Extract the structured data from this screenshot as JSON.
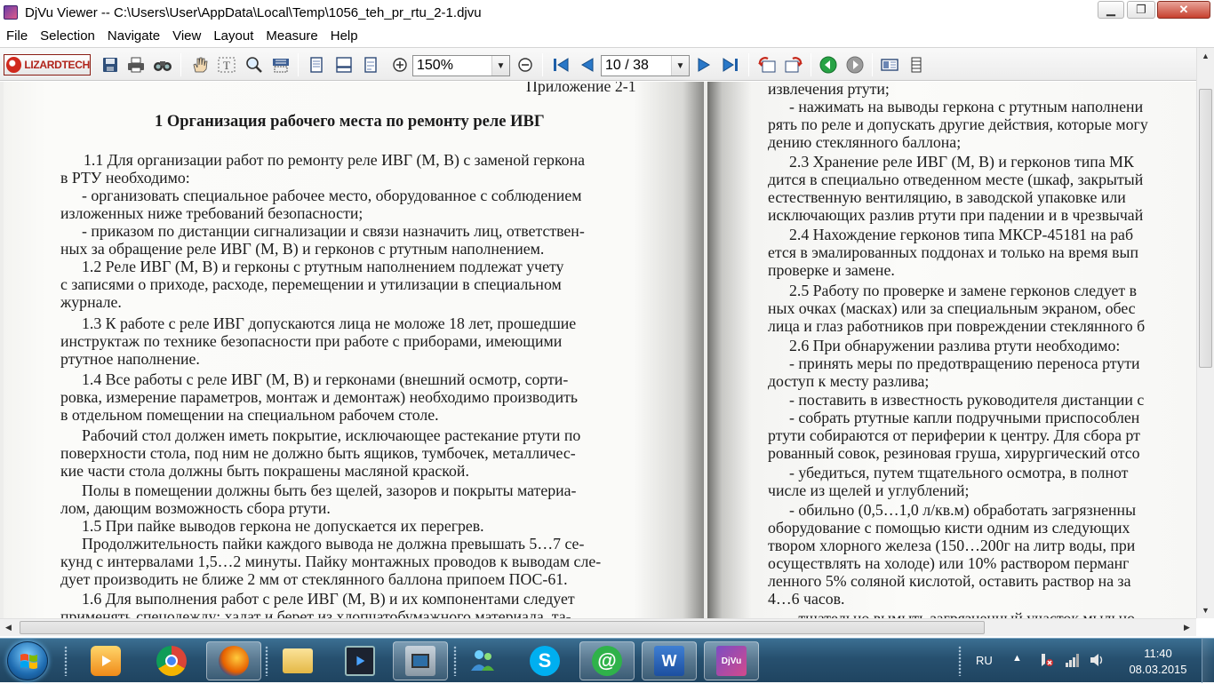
{
  "window": {
    "title": "DjVu Viewer -- C:\\Users\\User\\AppData\\Local\\Temp\\1056_teh_pr_rtu_2-1.djvu",
    "minimize_icon": "minimize-icon",
    "maximize_icon": "restore-icon",
    "close_icon": "close-icon"
  },
  "menu": [
    "File",
    "Selection",
    "Navigate",
    "View",
    "Layout",
    "Measure",
    "Help"
  ],
  "toolbar": {
    "logo_text": "LIZARDTECH",
    "zoom_value": "150%",
    "page_value": "10 / 38",
    "icons": [
      "save-icon",
      "print-icon",
      "find-icon",
      "hand-icon",
      "text-select-icon",
      "zoom-tool-icon",
      "region-select-icon",
      "single-page-icon",
      "continuous-page-icon",
      "facing-page-icon",
      "zoom-in-icon",
      "zoom-out-icon",
      "first-page-icon",
      "previous-page-icon",
      "next-page-icon",
      "last-page-icon",
      "rotate-left-icon",
      "rotate-right-icon",
      "back-icon",
      "forward-icon",
      "thumbnails-icon",
      "page-layout-icon"
    ]
  },
  "document": {
    "left_page": [
      "Приложение 2-1",
      "1 Организация рабочего места по ремонту реле ИВГ",
      "1.1 Для организации работ по ремонту реле ИВГ (М, В) с заменой геркона",
      "в РТУ необходимо:",
      "- организовать специальное рабочее место, оборудованное с соблюдением",
      "изложенных ниже требований безопасности;",
      "- приказом по дистанции сигнализации и связи назначить лиц, ответствен-",
      "ных за обращение реле ИВГ (М, В) и герконов с ртутным наполнением.",
      "1.2 Реле ИВГ (М, В) и герконы с ртутным наполнением подлежат учету",
      "с записями о приходе, расходе, перемещении и утилизации в специальном",
      "журнале.",
      "1.3 К работе с реле ИВГ допускаются лица не моложе 18 лет, прошедшие",
      "инструктаж по технике безопасности при работе с приборами, имеющими",
      "ртутное наполнение.",
      "1.4 Все работы с реле ИВГ (М, В) и герконами (внешний осмотр, сорти-",
      "ровка, измерение параметров, монтаж и демонтаж) необходимо производить",
      "в отдельном помещении на специальном рабочем столе.",
      "Рабочий стол должен иметь покрытие, исключающее растекание ртути по",
      "поверхности стола, под ним не должно быть ящиков, тумбочек, металличес-",
      "кие части стола должны быть покрашены масляной краской.",
      "Полы в помещении должны быть без щелей, зазоров и покрыты материа-",
      "лом, дающим возможность сбора ртути.",
      "1.5 При пайке выводов геркона не допускается их перегрев.",
      "Продолжительность пайки каждого вывода не должна превышать 5…7 се-",
      "кунд с интервалами 1,5…2 минуты. Пайку монтажных проводов к выводам сле-",
      "дует производить не ближе 2 мм от стеклянного баллона припоем ПОС-61.",
      "1.6 Для выполнения работ с реле ИВГ (М, В) и их компонентами следует",
      "применять спецодежду: халат и берет из хлопчатобумажного материала, та-"
    ],
    "right_page": [
      "извлечения ртути;",
      "- нажимать на выводы геркона с ртутным наполнени",
      "рять по реле и допускать другие действия, которые могу",
      "дению стеклянного баллона;",
      "2.3 Хранение реле ИВГ (М, В) и герконов типа МК",
      "дится в специально отведенном месте (шкаф, закрытый",
      "естественную вентиляцию, в заводской упаковке или",
      "исключающих разлив ртути при падении и в чрезвычай",
      "2.4 Нахождение герконов типа МКСР-45181 на раб",
      "ется в эмалированных поддонах и только на время вып",
      "проверке и замене.",
      "2.5 Работу по проверке и замене герконов следует в",
      "ных очках (масках) или за специальным экраном, обес",
      "лица и глаз работников при повреждении стеклянного б",
      "2.6 При обнаружении разлива ртути необходимо:",
      "- принять меры по предотвращению переноса ртути",
      "доступ к месту разлива;",
      "- поставить в известность руководителя дистанции с",
      "- собрать ртутные капли подручными приспособлен",
      "ртути собираются от периферии к центру. Для сбора рт",
      "рованный совок, резиновая груша, хирургический отсо",
      "- убедиться, путем тщательного осмотра, в полнот",
      "числе из щелей и углублений;",
      "- обильно (0,5…1,0 л/кв.м) обработать загрязненны",
      "оборудование с помощью кисти одним из следующих",
      "твором хлорного железа (150…200г на литр воды, при",
      "осуществлять на холоде) или 10% раствором перманг",
      "ленного 5% соляной кислотой, оставить раствор на за",
      "4…6 часов.",
      "- тщательно вымыть загрязненный участок мыльно"
    ]
  },
  "taskbar": {
    "apps": [
      "media-player-icon",
      "chrome-icon",
      "firefox-icon",
      "explorer-icon",
      "video-app-icon",
      "tv-app-icon",
      "users-app-icon",
      "skype-icon",
      "email-app-icon",
      "word-icon",
      "djvu-viewer-icon"
    ],
    "word_label": "W",
    "djvu_label": "DjVu",
    "language": "RU",
    "time": "11:40",
    "date": "08.03.2015"
  },
  "colors": {
    "accent_red": "#c7402e",
    "taskbar": "#27506f"
  }
}
